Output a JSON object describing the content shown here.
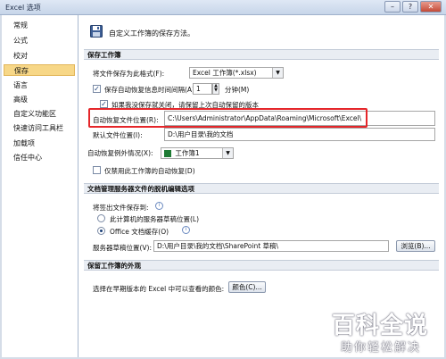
{
  "window": {
    "title": "Excel 选项",
    "minimize": "–",
    "maximize": "?",
    "close": "✕"
  },
  "sidebar": {
    "items": [
      {
        "label": "常规"
      },
      {
        "label": "公式"
      },
      {
        "label": "校对"
      },
      {
        "label": "保存",
        "selected": true
      },
      {
        "label": "语言"
      },
      {
        "label": "高级"
      },
      {
        "label": "自定义功能区"
      },
      {
        "label": "快速访问工具栏"
      },
      {
        "label": "加载项"
      },
      {
        "label": "信任中心"
      }
    ]
  },
  "header": {
    "text": "自定义工作簿的保存方法。",
    "icon": "save-disk-icon"
  },
  "save_workbooks": {
    "title": "保存工作簿",
    "format_label": "将文件保存为此格式(F):",
    "format_value": "Excel 工作簿(*.xlsx)",
    "autorecover_label": "保存自动恢复信息时间间隔(A)",
    "autorecover_checked": true,
    "autorecover_minutes": "1",
    "minutes_label": "分钟(M)",
    "keep_last_label": "如果我没保存就关闭，请保留上次自动保留的版本",
    "keep_last_checked": true,
    "autorecover_location_label": "自动恢复文件位置(R):",
    "autorecover_location_value": "C:\\Users\\Administrator\\AppData\\Roaming\\Microsoft\\Excel\\",
    "default_location_label": "默认文件位置(I):",
    "default_location_value": "D:\\用户目录\\我的文档"
  },
  "autorecover_exceptions": {
    "title": "自动恢复例外情况(X):",
    "workbook_value": "工作簿1",
    "disable_label": "仅禁用此工作簿的自动恢复(D)",
    "disable_checked": false
  },
  "offline_editing": {
    "title": "文档管理服务器文件的脱机编辑选项",
    "save_checked_out_label": "将签出文件保存到:",
    "option_server_drafts": "此计算机的服务器草稿位置(L)",
    "option_office_cache": "Office 文档缓存(O)",
    "selected_option": "office_cache",
    "server_drafts_label": "服务器草稿位置(V):",
    "server_drafts_value": "D:\\用户目录\\我的文档\\SharePoint 草稿\\",
    "browse_label": "浏览(B)..."
  },
  "appearance": {
    "title": "保留工作簿的外观",
    "colors_label": "选择在早期版本的 Excel 中可以查看的颜色:",
    "colors_button": "颜色(C)..."
  },
  "watermark": {
    "big": "百科全说",
    "small": "助你轻松解决"
  },
  "colors": {
    "highlight": "#e5262a",
    "selected_nav": "#f7d787",
    "excel_green": "#1e7b34"
  }
}
